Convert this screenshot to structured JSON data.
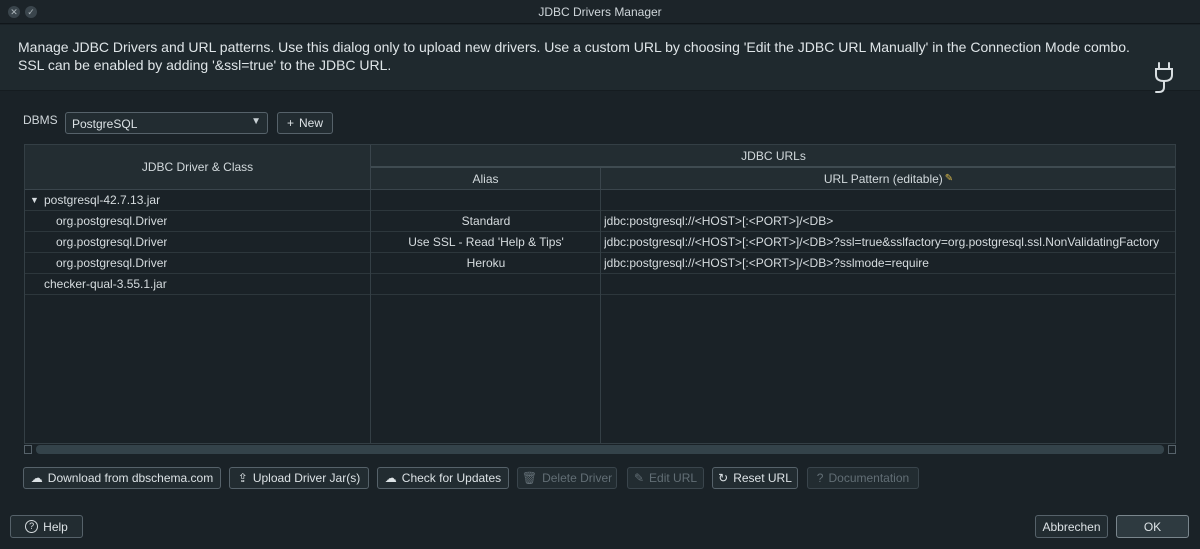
{
  "window": {
    "title": "JDBC Drivers Manager"
  },
  "info": {
    "line1": "Manage JDBC Drivers and URL patterns. Use this dialog only to upload new drivers. Use a custom URL by choosing 'Edit the JDBC URL Manually' in the Connection Mode combo.",
    "line2": "SSL can be enabled by adding '&ssl=true' to the JDBC URL."
  },
  "dbms": {
    "label": "DBMS",
    "selected": "PostgreSQL",
    "new_label": "New"
  },
  "table": {
    "headers": {
      "driver_class": "JDBC Driver & Class",
      "jdbc_urls": "JDBC URLs",
      "alias": "Alias",
      "url_pattern": "URL Pattern (editable)"
    },
    "rows": [
      {
        "driver": "postgresql-42.7.13.jar",
        "alias": "",
        "url": "",
        "level": 0,
        "expanded": true
      },
      {
        "driver": "org.postgresql.Driver",
        "alias": "Standard",
        "url": "jdbc:postgresql://<HOST>[:<PORT>]/<DB>",
        "level": 1
      },
      {
        "driver": "org.postgresql.Driver",
        "alias": "Use SSL - Read 'Help & Tips'",
        "url": "jdbc:postgresql://<HOST>[:<PORT>]/<DB>?ssl=true&sslfactory=org.postgresql.ssl.NonValidatingFactory",
        "level": 1
      },
      {
        "driver": "org.postgresql.Driver",
        "alias": "Heroku",
        "url": "jdbc:postgresql://<HOST>[:<PORT>]/<DB>?sslmode=require",
        "level": 1
      },
      {
        "driver": "checker-qual-3.55.1.jar",
        "alias": "",
        "url": "",
        "level": 0
      }
    ]
  },
  "actions": {
    "download": "Download from dbschema.com",
    "upload": "Upload Driver Jar(s)",
    "check_updates": "Check for Updates",
    "delete_driver": "Delete Driver",
    "edit_url": "Edit URL",
    "reset_url": "Reset URL",
    "documentation": "Documentation"
  },
  "footer": {
    "help": "Help",
    "cancel": "Abbrechen",
    "ok": "OK"
  },
  "colors": {
    "background": "#1a2227",
    "border": "#56626a",
    "text": "#d4dadd"
  }
}
